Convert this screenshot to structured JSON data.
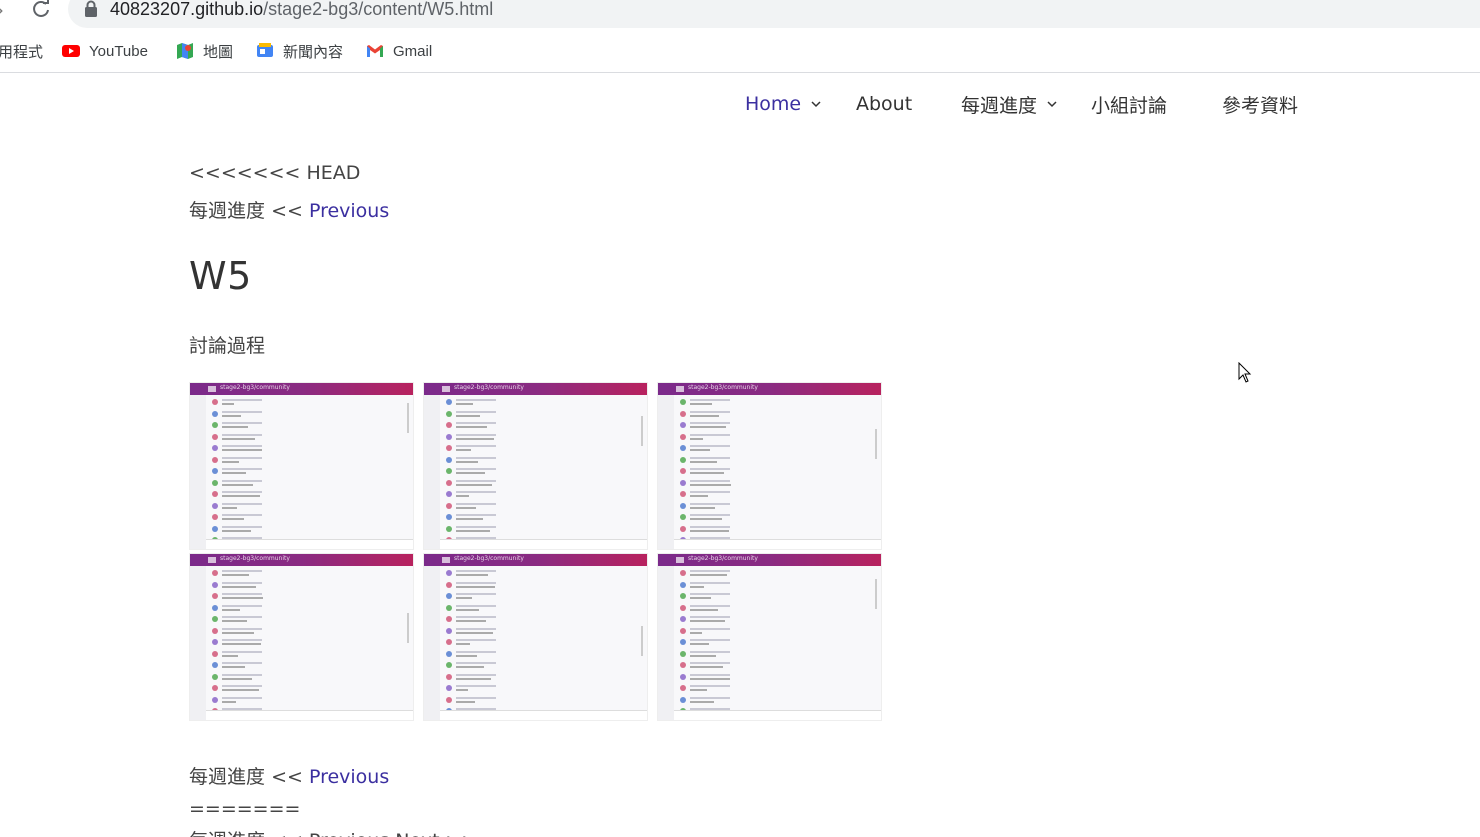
{
  "browser": {
    "url_host": "40823207.github.io",
    "url_path": "/stage2-bg3/content/W5.html",
    "bookmarks": [
      {
        "label": "用程式",
        "icon": "apps-icon"
      },
      {
        "label": "YouTube",
        "icon": "youtube-icon"
      },
      {
        "label": "地圖",
        "icon": "maps-icon"
      },
      {
        "label": "新聞內容",
        "icon": "news-icon"
      },
      {
        "label": "Gmail",
        "icon": "gmail-icon"
      }
    ]
  },
  "nav": {
    "home": "Home",
    "about": "About",
    "weekly": "每週進度",
    "group": "小組討論",
    "refs": "參考資料"
  },
  "content": {
    "head_marker": "<<<<<<< HEAD",
    "breadcrumb_label": "每週進度",
    "prev_sep": "<<",
    "prev_link": "Previous",
    "title": "W5",
    "section": "討論過程",
    "bottom_label": "每週進度",
    "bottom_sep": "<<",
    "bottom_prev": "Previous",
    "conflict_marker": "=======",
    "cut_line": "每週進度 << Previous Next >> "
  },
  "gallery": {
    "thumb_title": "stage2-bg3/community",
    "thumb_count": 6
  },
  "colors": {
    "link": "#3b2fa0",
    "header_grad_start": "#7b2a8a",
    "header_grad_end": "#b8225e"
  }
}
